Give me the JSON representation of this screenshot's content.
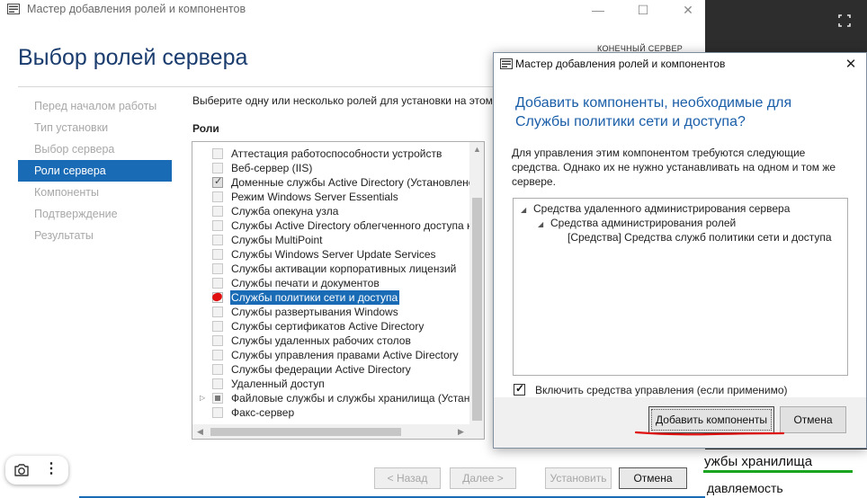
{
  "main_window": {
    "title": "Мастер добавления ролей и компонентов",
    "controls": {
      "minimize": "—",
      "maximize": "☐",
      "close": "✕"
    },
    "heading": "Выбор ролей сервера",
    "destination_label": "КОНЕЧНЫЙ СЕРВЕР",
    "steps": [
      {
        "label": "Перед началом работы",
        "active": false
      },
      {
        "label": "Тип установки",
        "active": false
      },
      {
        "label": "Выбор сервера",
        "active": false
      },
      {
        "label": "Роли сервера",
        "active": true
      },
      {
        "label": "Компоненты",
        "active": false
      },
      {
        "label": "Подтверждение",
        "active": false
      },
      {
        "label": "Результаты",
        "active": false
      }
    ],
    "instruction": "Выберите одну или несколько ролей для установки на этом",
    "roles_label": "Роли",
    "roles": [
      {
        "label": "Аттестация работоспособности устройств",
        "state": "unchecked",
        "expandable": false,
        "selected": false
      },
      {
        "label": "Веб-сервер (IIS)",
        "state": "unchecked",
        "expandable": false,
        "selected": false
      },
      {
        "label": "Доменные службы Active Directory (Установлено)",
        "state": "checked",
        "expandable": false,
        "selected": false
      },
      {
        "label": "Режим Windows Server Essentials",
        "state": "unchecked",
        "expandable": false,
        "selected": false
      },
      {
        "label": "Служба опекуна узла",
        "state": "unchecked",
        "expandable": false,
        "selected": false
      },
      {
        "label": "Службы Active Directory облегченного доступа к каталогам",
        "state": "unchecked",
        "expandable": false,
        "selected": false
      },
      {
        "label": "Службы MultiPoint",
        "state": "unchecked",
        "expandable": false,
        "selected": false
      },
      {
        "label": "Службы Windows Server Update Services",
        "state": "unchecked",
        "expandable": false,
        "selected": false
      },
      {
        "label": "Службы активации корпоративных лицензий",
        "state": "unchecked",
        "expandable": false,
        "selected": false
      },
      {
        "label": "Службы печати и документов",
        "state": "unchecked",
        "expandable": false,
        "selected": false
      },
      {
        "label": "Службы политики сети и доступа",
        "state": "marked",
        "expandable": false,
        "selected": true
      },
      {
        "label": "Службы развертывания Windows",
        "state": "unchecked",
        "expandable": false,
        "selected": false
      },
      {
        "label": "Службы сертификатов Active Directory",
        "state": "unchecked",
        "expandable": false,
        "selected": false
      },
      {
        "label": "Службы удаленных рабочих столов",
        "state": "unchecked",
        "expandable": false,
        "selected": false
      },
      {
        "label": "Службы управления правами Active Directory",
        "state": "unchecked",
        "expandable": false,
        "selected": false
      },
      {
        "label": "Службы федерации Active Directory",
        "state": "unchecked",
        "expandable": false,
        "selected": false
      },
      {
        "label": "Удаленный доступ",
        "state": "unchecked",
        "expandable": false,
        "selected": false
      },
      {
        "label": "Файловые службы и службы хранилища (Установлено)",
        "state": "partial",
        "expandable": true,
        "selected": false
      },
      {
        "label": "Факс-сервер",
        "state": "unchecked",
        "expandable": false,
        "selected": false
      }
    ],
    "buttons": {
      "back": "< Назад",
      "next": "Далее >",
      "install": "Установить",
      "cancel": "Отмена"
    }
  },
  "dialog": {
    "title": "Мастер добавления ролей и компонентов",
    "close_glyph": "✕",
    "heading": "Добавить компоненты, необходимые для Службы политики сети и доступа?",
    "description": "Для управления этим компонентом требуются следующие средства. Однако их не нужно устанавливать на одном и том же сервере.",
    "tree": [
      "Средства удаленного администрирования сервера",
      "Средства администрирования ролей",
      "[Средства] Средства служб политики сети и доступа"
    ],
    "include_tools": {
      "label": "Включить средства управления (если применимо)",
      "checked": true
    },
    "buttons": {
      "add": "Добавить компоненты",
      "cancel": "Отмена"
    }
  },
  "background": {
    "text_1": "ужбы хранилища",
    "text_2": "давляемость"
  },
  "icons": {
    "camera": "camera-icon",
    "more": "more-vertical-icon",
    "fullscreen": "fullscreen-icon",
    "wizard": "server-manager-icon"
  },
  "colors": {
    "accent": "#1a6bb5",
    "heading": "#1a3c6e",
    "dialog_heading": "#1a5ea8",
    "annotation_red": "#e01010",
    "annotation_green": "#19a51f"
  }
}
